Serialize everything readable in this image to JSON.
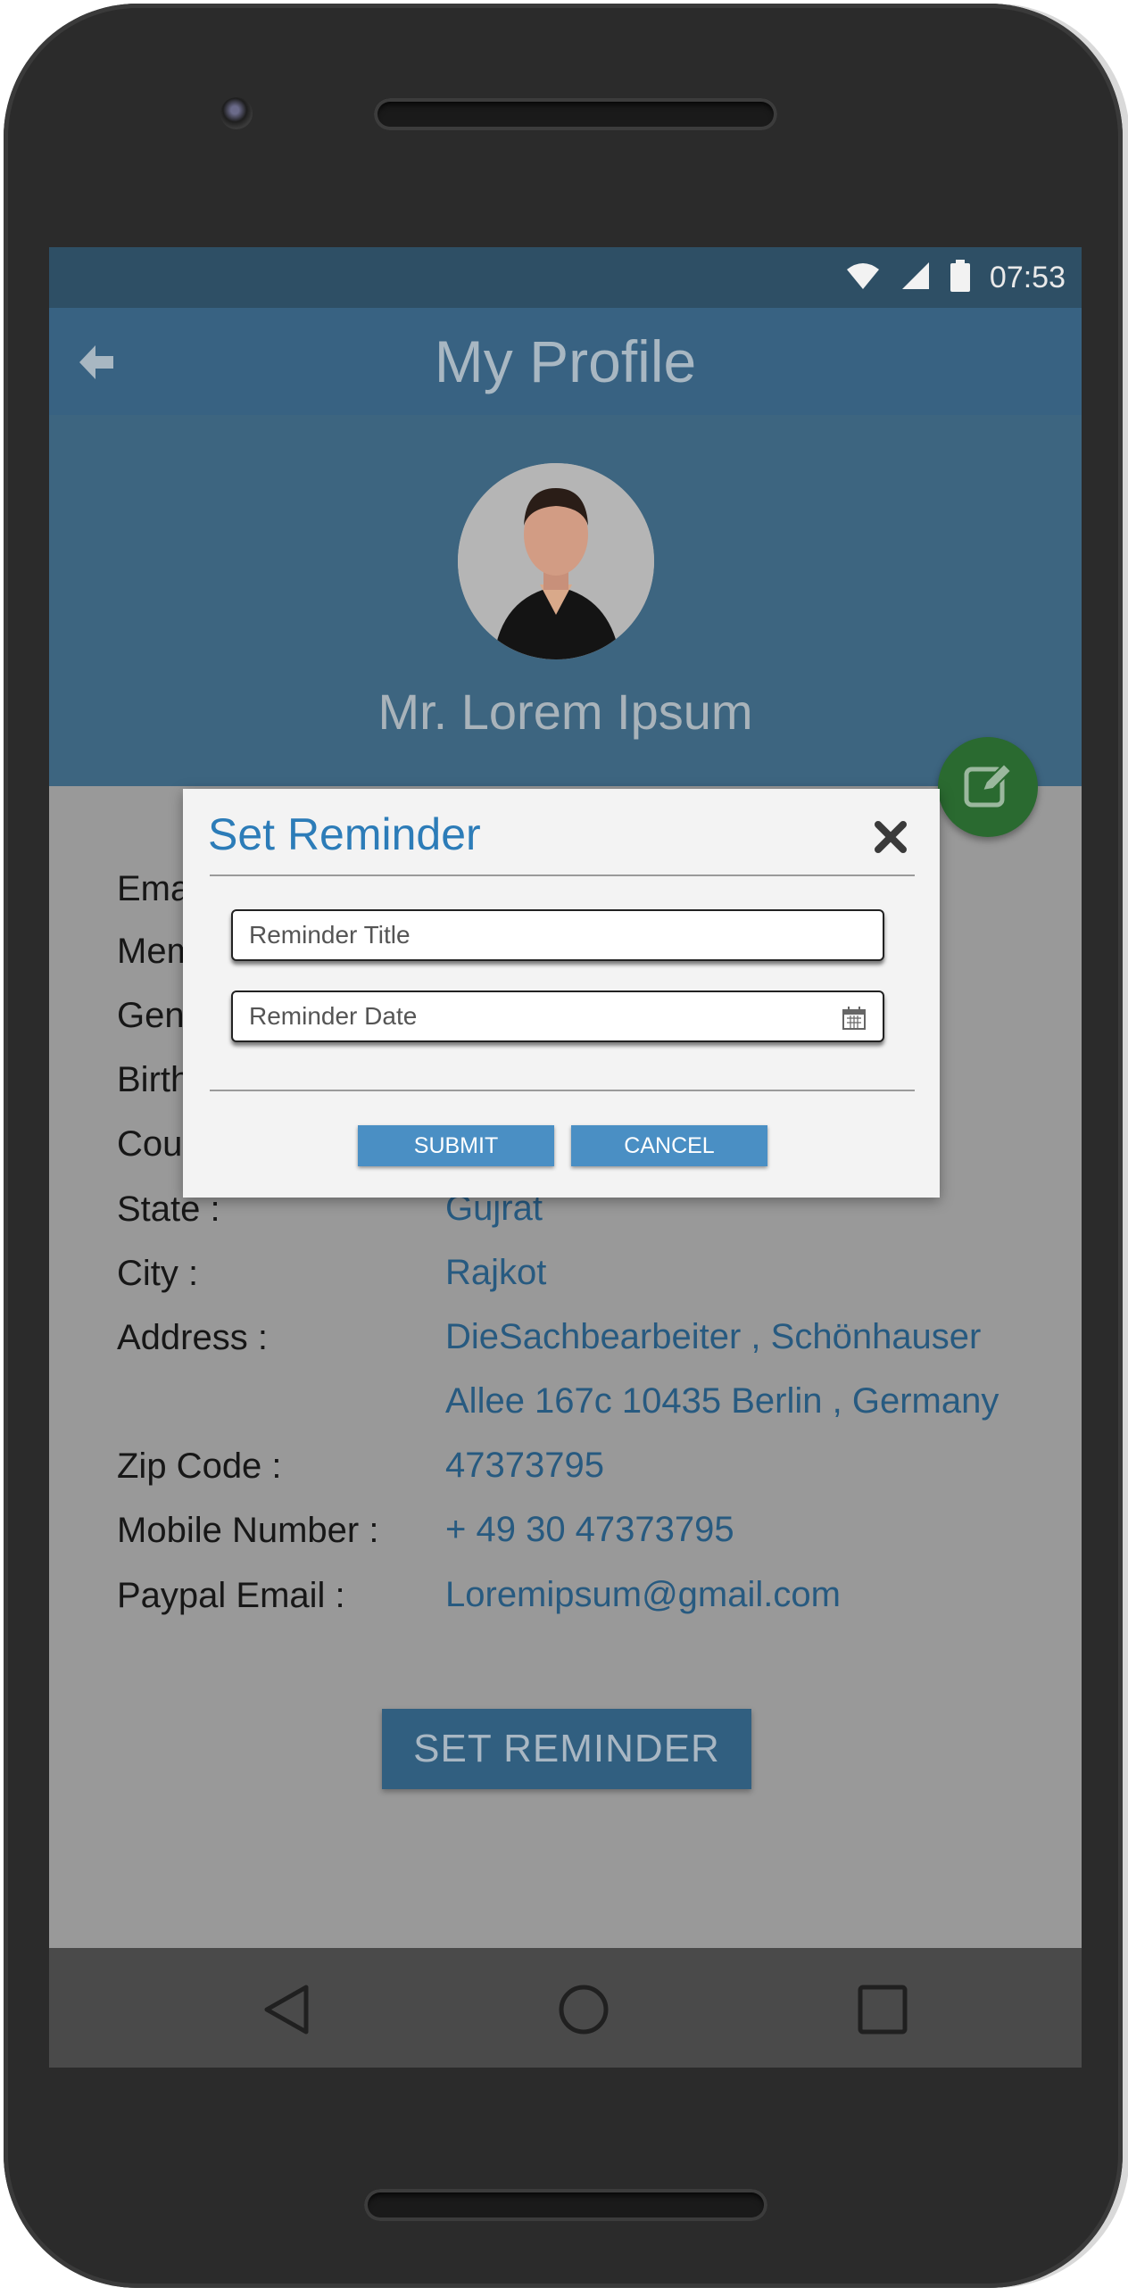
{
  "status_bar": {
    "time": "07:53"
  },
  "app_bar": {
    "title": "My Profile"
  },
  "profile": {
    "name": "Mr. Lorem Ipsum"
  },
  "details": {
    "rows": [
      {
        "label": "Ema",
        "value": ""
      },
      {
        "label": "Mem",
        "value": ""
      },
      {
        "label": "Gen",
        "value": ""
      },
      {
        "label": "Birth",
        "value": ""
      },
      {
        "label": "Cou",
        "value": ""
      },
      {
        "label": "State :",
        "value": "Gujrat"
      },
      {
        "label": "City :",
        "value": "Rajkot"
      },
      {
        "label": "Address :",
        "value": "DieSachbearbeiter , Schönhauser Allee 167c 10435 Berlin , Germany"
      },
      {
        "label": "Zip Code :",
        "value": "47373795"
      },
      {
        "label": "Mobile Number :",
        "value": "+ 49 30 47373795"
      },
      {
        "label": "Paypal Email :",
        "value": "Loremipsum@gmail.com"
      }
    ]
  },
  "set_reminder_button": {
    "label": "SET REMINDER"
  },
  "dialog": {
    "title": "Set Reminder",
    "title_input": {
      "placeholder": "Reminder Title"
    },
    "date_input": {
      "placeholder": "Reminder Date"
    },
    "submit_label": "SUBMIT",
    "cancel_label": "CANCEL"
  },
  "icons": {
    "back": "back-arrow-icon",
    "edit": "edit-icon",
    "close": "close-icon",
    "calendar": "calendar-icon",
    "wifi": "wifi-icon",
    "signal": "signal-icon",
    "battery": "battery-icon",
    "nav_back": "nav-back-icon",
    "nav_home": "nav-home-icon",
    "nav_recents": "nav-recents-icon"
  },
  "colors": {
    "app_bar": "#386282",
    "header": "#3d6580",
    "value_text": "#275a80",
    "dialog_title": "#2c7cb8",
    "dialog_button": "#4a8fc4",
    "edit_fab": "#2a6a30"
  }
}
